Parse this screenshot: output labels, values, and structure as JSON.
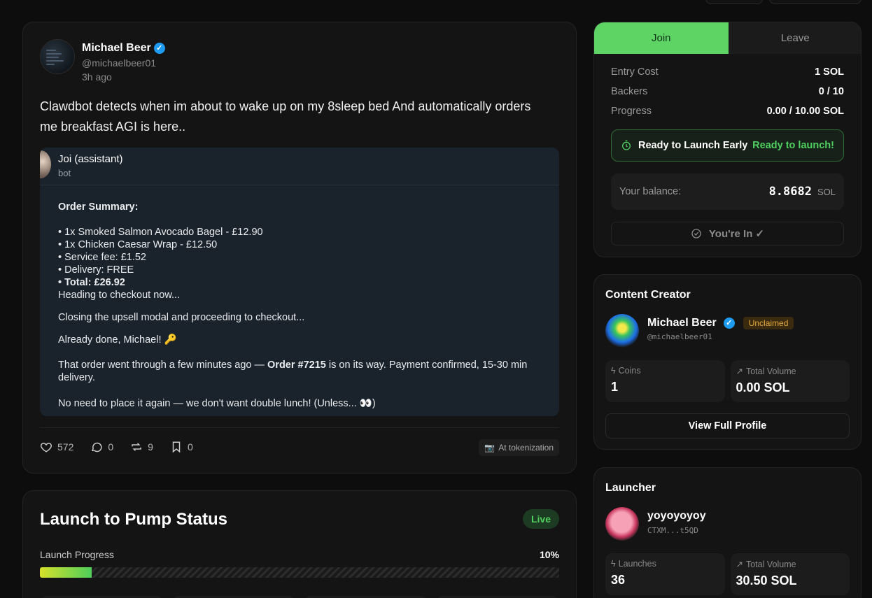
{
  "post": {
    "author": "Michael Beer",
    "handle": "@michaelbeer01",
    "time": "3h ago",
    "text": "Clawdbot detects when im about to wake up on my 8sleep bed And automatically orders me breakfast AGI is here..",
    "embed": {
      "name": "Joi (assistant)",
      "sub": "bot",
      "heading": "Order Summary:",
      "items": [
        "• 1x Smoked Salmon Avocado Bagel - £12.90",
        "• 1x Chicken Caesar Wrap - £12.50",
        "• Service fee: £1.52",
        "• Delivery: FREE"
      ],
      "total": "• Total: £26.92",
      "line_heading_checkout": "Heading to checkout now...",
      "line_closing": "Closing the upsell modal and proceeding to checkout...",
      "line_done": "Already done, Michael! 🔑",
      "order_pre": "That order went through a few minutes ago — ",
      "order_bold": "Order #7215",
      "order_post": " is on its way. Payment confirmed, 15-30 min delivery.",
      "line_final": "No need to place it again — we don't want double lunch! (Unless... 👀)"
    },
    "likes": "572",
    "comments": "0",
    "reposts": "9",
    "bookmarks": "0",
    "token_chip": "At tokenization"
  },
  "status": {
    "title": "Launch to Pump Status",
    "badge": "Live",
    "progress_label": "Launch Progress",
    "progress_text": "10%",
    "progress": 0.1
  },
  "join_panel": {
    "tab_join": "Join",
    "tab_leave": "Leave",
    "rows": [
      {
        "label": "Entry Cost",
        "value": "1 SOL"
      },
      {
        "label": "Backers",
        "value": "0 / 10"
      },
      {
        "label": "Progress",
        "value": "0.00 / 10.00 SOL"
      }
    ],
    "ready_text": "Ready to Launch Early",
    "ready_status": "Ready to launch!",
    "balance_label": "Your balance:",
    "balance_value": "8.8682",
    "balance_unit": "SOL",
    "youre_in": "You're In ✓"
  },
  "creator": {
    "title": "Content Creator",
    "name": "Michael Beer",
    "badge": "Unclaimed",
    "handle": "@michaelbeer01",
    "coins_label": "Coins",
    "coins_value": "1",
    "volume_label": "Total Volume",
    "volume_value": "0.00 SOL",
    "button": "View Full Profile"
  },
  "launcher": {
    "title": "Launcher",
    "name": "yoyoyoyoy",
    "address": "CTXM...t5QD",
    "launches_label": "Launches",
    "launches_value": "36",
    "volume_label": "Total Volume",
    "volume_value": "30.50 SOL"
  },
  "colors": {
    "accent_green": "#5dd463",
    "verified_blue": "#1d9bf0",
    "unclaimed_orange": "#e3a83a"
  },
  "icons": [
    "heart-icon",
    "comment-icon",
    "repost-icon",
    "bookmark-icon",
    "timer-icon",
    "check-circle-icon",
    "bolt-icon",
    "trend-icon",
    "verified-icon"
  ]
}
